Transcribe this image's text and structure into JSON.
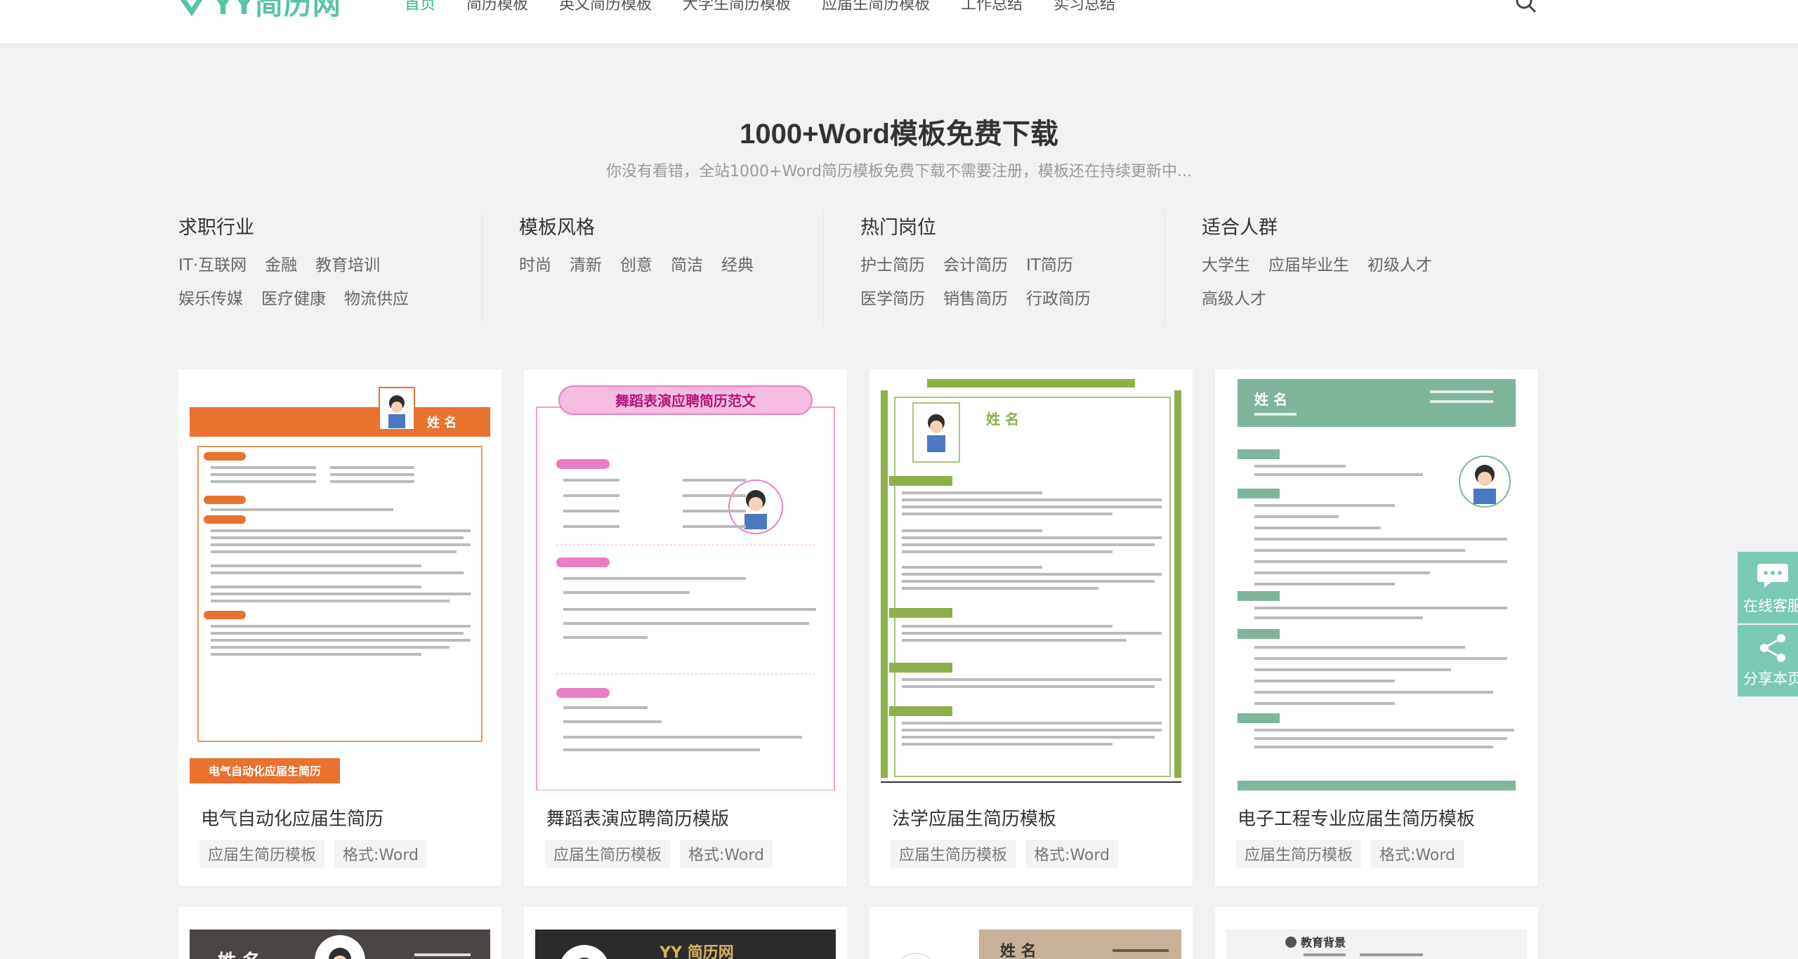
{
  "header": {
    "logo_text": "YY简历网",
    "nav": [
      "首页",
      "简历模板",
      "英文简历模板",
      "大学生简历模板",
      "应届生简历模板",
      "工作总结",
      "实习总结"
    ],
    "active_index": 0,
    "accent_color": "#2fb792"
  },
  "hero": {
    "title": "1000+Word模板免费下载",
    "subtitle": "你没有看错，全站1000+Word简历模板免费下载不需要注册，模板还在持续更新中..."
  },
  "categories": [
    {
      "title": "求职行业",
      "links": [
        "IT·互联网",
        "金融",
        "教育培训",
        "娱乐传媒",
        "医疗健康",
        "物流供应"
      ]
    },
    {
      "title": "模板风格",
      "links": [
        "时尚",
        "清新",
        "创意",
        "简洁",
        "经典"
      ]
    },
    {
      "title": "热门岗位",
      "links": [
        "护士简历",
        "会计简历",
        "IT简历",
        "医学简历",
        "销售简历",
        "行政简历"
      ]
    },
    {
      "title": "适合人群",
      "links": [
        "大学生",
        "应届毕业生",
        "初级人才",
        "高级人才"
      ]
    }
  ],
  "cards": [
    {
      "title": "电气自动化应届生简历",
      "tags": [
        "应届生简历模板",
        "格式:Word"
      ],
      "thumb_name": "姓 名",
      "thumb_footer": "电气自动化应届生简历",
      "accent": "#e8722e"
    },
    {
      "title": "舞蹈表演应聘简历模版",
      "tags": [
        "应届生简历模板",
        "格式:Word"
      ],
      "thumb_header": "舞蹈表演应聘简历范文",
      "accent": "#e87fc4"
    },
    {
      "title": "法学应届生简历模板",
      "tags": [
        "应届生简历模板",
        "格式:Word"
      ],
      "thumb_name": "姓 名",
      "accent": "#8db04b"
    },
    {
      "title": "电子工程专业应届生简历模板",
      "tags": [
        "应届生简历模板",
        "格式:Word"
      ],
      "thumb_name": "姓 名",
      "accent": "#7fb59b"
    }
  ],
  "row2": [
    {
      "thumb_name": "姓 名",
      "bg": "#4a4643"
    },
    {
      "thumb_brand": "YY 简历网",
      "bg": "#2b2b2b"
    },
    {
      "thumb_name": "姓 名",
      "bg": "#c7b299"
    },
    {
      "thumb_label": "教育背景",
      "bg": "#f3f3f3"
    }
  ],
  "float_bar": [
    {
      "label": "在线客服",
      "icon": "chat-icon"
    },
    {
      "label": "分享本页",
      "icon": "share-icon"
    }
  ]
}
